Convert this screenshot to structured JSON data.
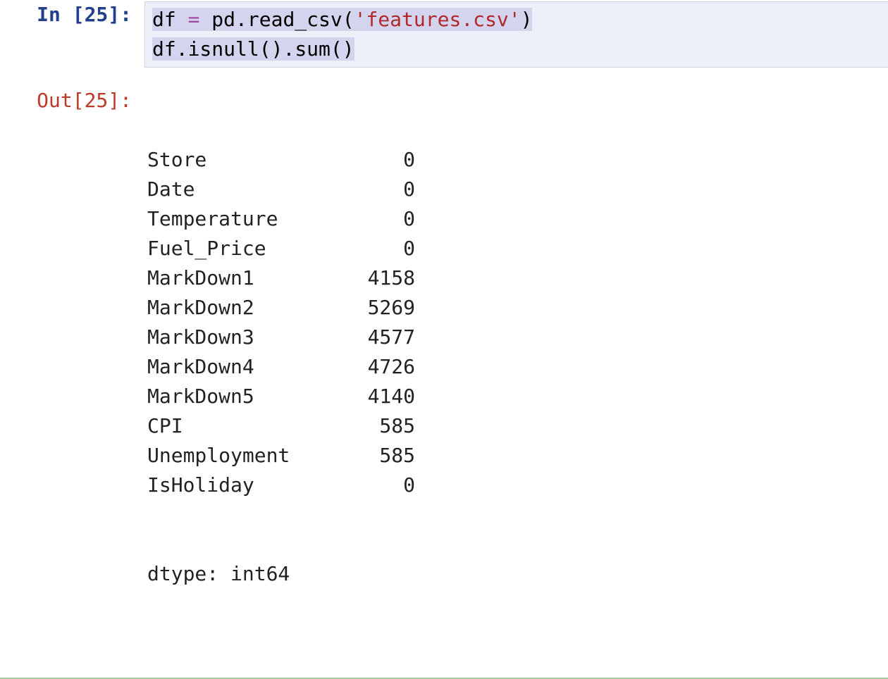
{
  "input": {
    "prompt": "In [25]:",
    "line1": {
      "var": "df",
      "sp0": " ",
      "eq": "=",
      "sp1": " ",
      "pd": "pd",
      "dot": ".",
      "fn": "read_csv",
      "lpar": "(",
      "q1": "'",
      "str": "features.csv",
      "q2": "'",
      "rpar": ")"
    },
    "line2": {
      "var": "df",
      "dot1": ".",
      "fn1": "isnull",
      "p1": "()",
      "dot2": ".",
      "fn2": "sum",
      "p2": "()"
    }
  },
  "output": {
    "prompt": "Out[25]:",
    "rows": [
      {
        "key": "Store",
        "val": "0"
      },
      {
        "key": "Date",
        "val": "0"
      },
      {
        "key": "Temperature",
        "val": "0"
      },
      {
        "key": "Fuel_Price",
        "val": "0"
      },
      {
        "key": "MarkDown1",
        "val": "4158"
      },
      {
        "key": "MarkDown2",
        "val": "5269"
      },
      {
        "key": "MarkDown3",
        "val": "4577"
      },
      {
        "key": "MarkDown4",
        "val": "4726"
      },
      {
        "key": "MarkDown5",
        "val": "4140"
      },
      {
        "key": "CPI",
        "val": "585"
      },
      {
        "key": "Unemployment",
        "val": "585"
      },
      {
        "key": "IsHoliday",
        "val": "0"
      }
    ],
    "dtype": "dtype: int64"
  }
}
